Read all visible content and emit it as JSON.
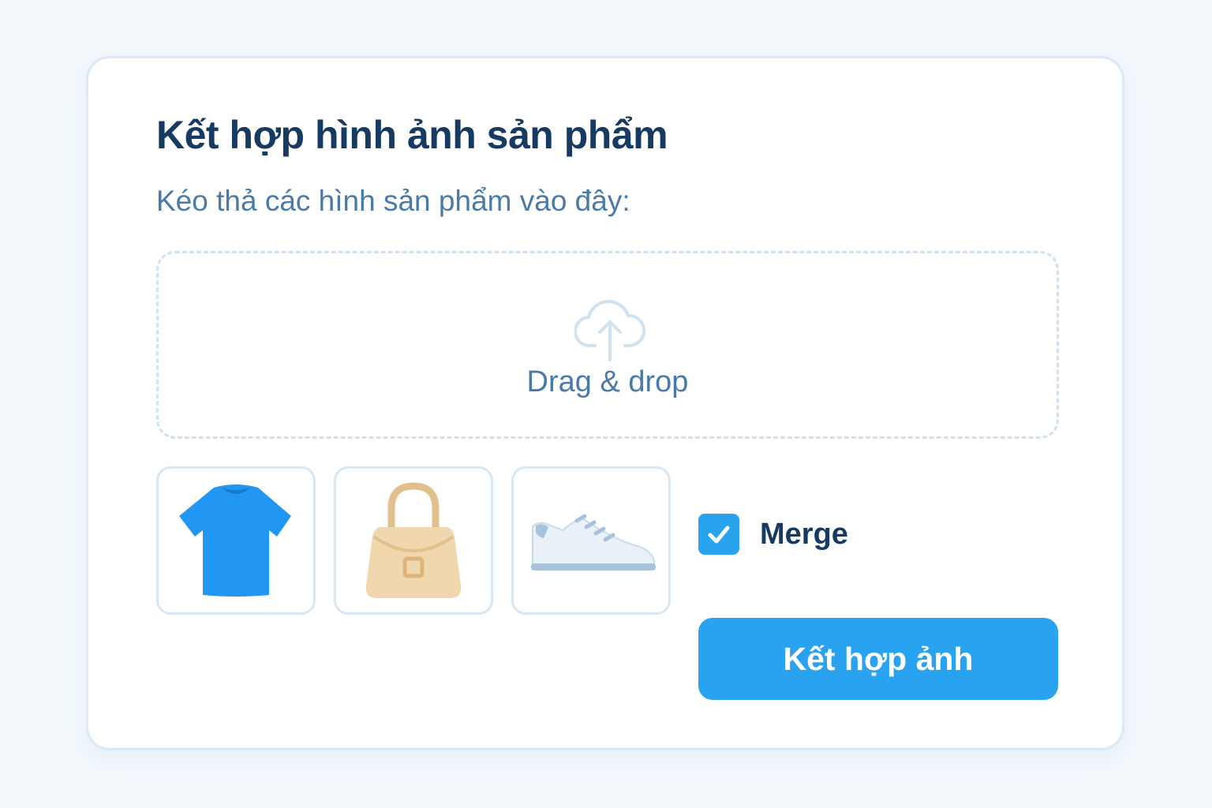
{
  "card": {
    "title": "Kết hợp hình ảnh sản phẩm",
    "subtitle": "Kéo thả các hình sản phẩm vào đây:"
  },
  "dropzone": {
    "icon": "cloud-upload-icon",
    "label": "Drag & drop"
  },
  "thumbnails": [
    {
      "icon": "t-shirt-icon",
      "color": "#2196f3"
    },
    {
      "icon": "handbag-icon",
      "color": "#f0d7ad"
    },
    {
      "icon": "sneaker-icon",
      "color": "#e9f1f8"
    }
  ],
  "merge_option": {
    "label": "Merge",
    "checked": true
  },
  "action_button": {
    "label": "Kết hợp ảnh"
  },
  "colors": {
    "primary": "#29a3f0",
    "title": "#173a63",
    "muted": "#4a7aa8",
    "border": "#d9e9f5",
    "background": "#f3f9fd"
  }
}
